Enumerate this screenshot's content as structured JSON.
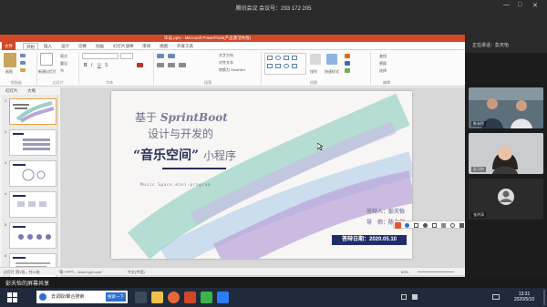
{
  "meeting": {
    "title": "腾讯会议 会议号：293 172 205",
    "controls": [
      "—",
      "□",
      "✕"
    ]
  },
  "ppt": {
    "window_title": "毕设.pptx - Microsoft PowerPoint(产品激活失败)",
    "tabs": [
      "文件",
      "开始",
      "插入",
      "设计",
      "切换",
      "动画",
      "幻灯片放映",
      "审阅",
      "视图",
      "开发工具"
    ],
    "active_tab": "开始",
    "ribbon_groups": [
      "剪贴板",
      "幻灯片",
      "字体",
      "段落",
      "绘图",
      "编辑"
    ],
    "ribbon_labels": {
      "paste": "粘贴",
      "new_slide": "新建幻灯片",
      "layout": "版式",
      "reset": "重设",
      "section": "节",
      "text_direction": "文字方向",
      "align_text": "对齐文本",
      "convert_smartart": "转换为 SmartArt",
      "arrange": "排列",
      "quick_styles": "快速样式",
      "find": "查找",
      "replace": "替换",
      "select": "选择"
    },
    "panel_tabs": [
      "幻灯片",
      "大纲"
    ],
    "thumbnails": [
      {
        "num": "1"
      },
      {
        "num": "2"
      },
      {
        "num": "3"
      },
      {
        "num": "4"
      },
      {
        "num": "5"
      },
      {
        "num": "6"
      }
    ],
    "status": {
      "slide_info": "幻灯片 第1张，共13张",
      "theme": "\"第一PPT，www.1ppt.com\"",
      "language": "中文(中国)",
      "zoom": "63%"
    }
  },
  "slide": {
    "line1_prefix": "基于",
    "line1_brand": "SprintBoot",
    "line2": "设计与开发的",
    "line3_main": "“音乐空间”",
    "line3_small": "小程序",
    "english": "Music Space mini-program",
    "author": "答辩人：彭天怡",
    "advisor": "导　师：陈永恒",
    "date": "答辩日期：2020.05.10"
  },
  "participants": {
    "header": "正在讲话：彭天怡",
    "tiles": [
      {
        "name": "陈永恒"
      },
      {
        "name": "彭天怡"
      },
      {
        "name": "张洪涛"
      }
    ]
  },
  "share_banner": "彭天怡的屏幕共享",
  "taskbar": {
    "search_placeholder": "去调取/聚合搜索",
    "search_button": "搜索一下",
    "time": "13:31",
    "date": "2020/5/10"
  }
}
